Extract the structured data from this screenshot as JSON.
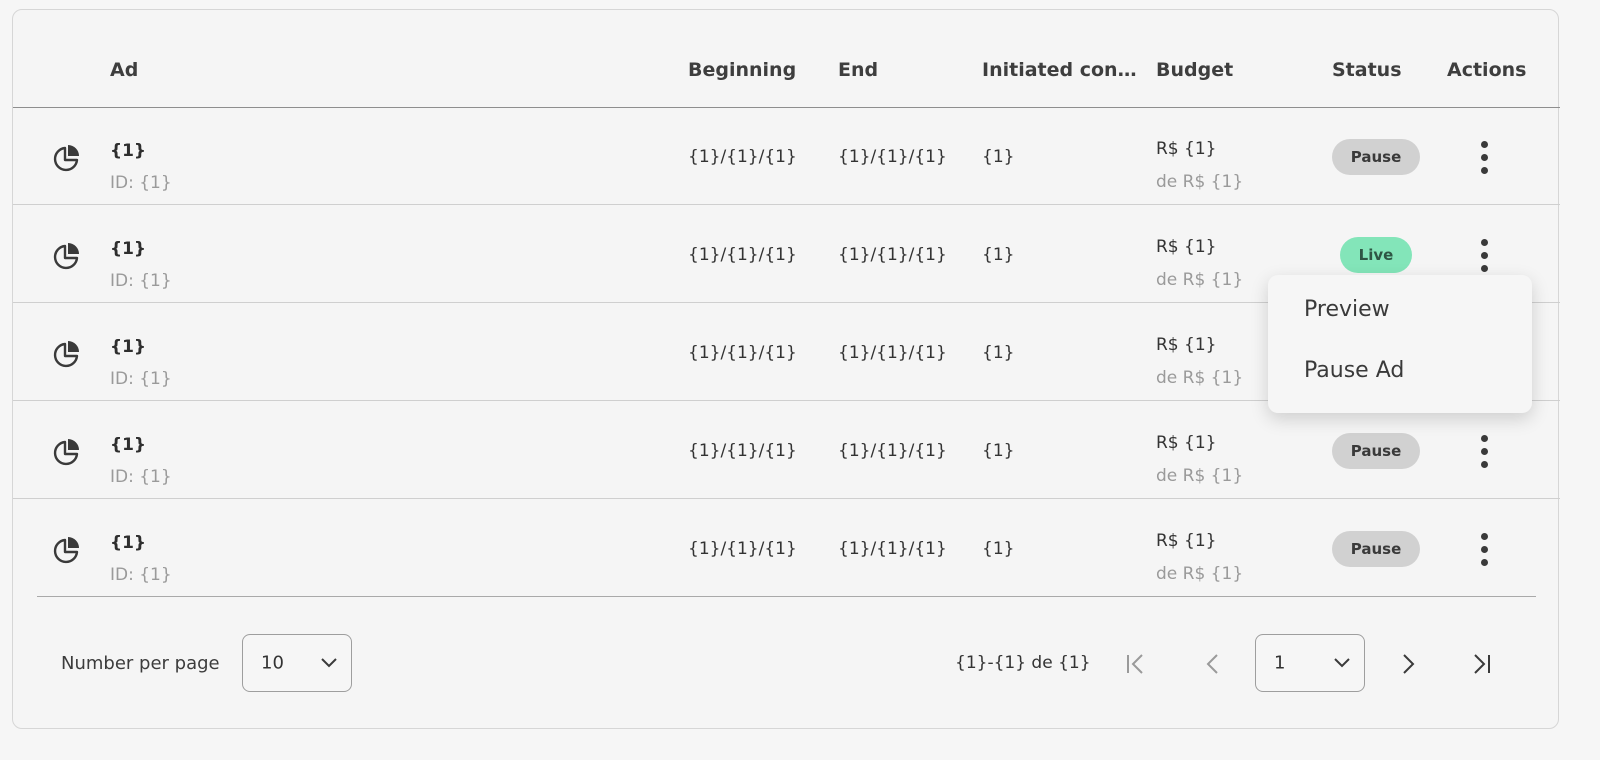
{
  "table": {
    "headers": {
      "ad": "Ad",
      "beginning": "Beginning",
      "end": "End",
      "conversions": "Initiated conve...",
      "budget": "Budget",
      "status": "Status",
      "actions": "Actions"
    },
    "rows": [
      {
        "name": "{1}",
        "id": "ID: {1}",
        "beginning": "{1}/{1}/{1}",
        "end": "{1}/{1}/{1}",
        "conversions": "{1}",
        "budget": "R$ {1}",
        "budget_total": "de R$ {1}",
        "status": "Pause",
        "icon": "pie-chart-icon"
      },
      {
        "name": "{1}",
        "id": "ID: {1}",
        "beginning": "{1}/{1}/{1}",
        "end": "{1}/{1}/{1}",
        "conversions": "{1}",
        "budget": "R$ {1}",
        "budget_total": "de R$ {1}",
        "status": "Live",
        "icon": "pie-chart-icon"
      },
      {
        "name": "{1}",
        "id": "ID: {1}",
        "beginning": "{1}/{1}/{1}",
        "end": "{1}/{1}/{1}",
        "conversions": "{1}",
        "budget": "R$ {1}",
        "budget_total": "de R$ {1}",
        "status": "",
        "icon": "pie-chart-icon"
      },
      {
        "name": "{1}",
        "id": "ID: {1}",
        "beginning": "{1}/{1}/{1}",
        "end": "{1}/{1}/{1}",
        "conversions": "{1}",
        "budget": "R$ {1}",
        "budget_total": "de R$ {1}",
        "status": "Pause",
        "icon": "pie-chart-icon"
      },
      {
        "name": "{1}",
        "id": "ID: {1}",
        "beginning": "{1}/{1}/{1}",
        "end": "{1}/{1}/{1}",
        "conversions": "{1}",
        "budget": "R$ {1}",
        "budget_total": "de R$ {1}",
        "status": "Pause",
        "icon": "pie-chart-icon"
      }
    ]
  },
  "menu": {
    "items": [
      "Preview",
      "Pause Ad"
    ]
  },
  "footer": {
    "per_page_label": "Number per page",
    "per_page_value": "10",
    "range": "{1}-{1} de {1}",
    "page_value": "1"
  },
  "colors": {
    "pause_badge": "#d1d1d1",
    "live_badge": "#83e5b9",
    "page_bg": "#f6f6f6"
  }
}
